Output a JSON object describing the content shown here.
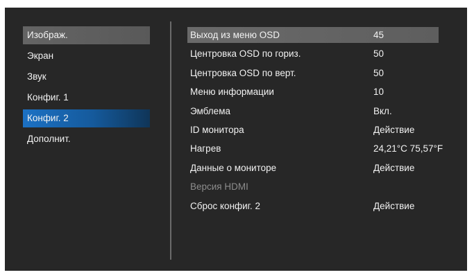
{
  "left_menu": {
    "items": [
      {
        "label": "Изображ."
      },
      {
        "label": "Экран"
      },
      {
        "label": "Звук"
      },
      {
        "label": "Конфиг. 1"
      },
      {
        "label": "Конфиг. 2"
      },
      {
        "label": "Дополнит."
      }
    ],
    "selected_index": 4,
    "highlighted_index": 0
  },
  "settings": {
    "rows": [
      {
        "label": "Выход из меню OSD",
        "value": "45"
      },
      {
        "label": "Центровка OSD по гориз.",
        "value": "50"
      },
      {
        "label": "Центровка OSD по верт.",
        "value": "50"
      },
      {
        "label": "Меню информации",
        "value": "10"
      },
      {
        "label": "Эмблема",
        "value": "Вкл."
      },
      {
        "label": "ID монитора",
        "value": "Действие"
      },
      {
        "label": "Нагрев",
        "value": "24,21°C 75,57°F"
      },
      {
        "label": "Данные о мониторе",
        "value": "Действие"
      },
      {
        "label": "Версия HDMI",
        "value": ""
      },
      {
        "label": "Сброс конфиг. 2",
        "value": "Действие"
      }
    ],
    "highlighted_index": 0,
    "disabled_index": 8
  },
  "colors": {
    "panel_background": "#272727",
    "selected_accent": "#1c71c4",
    "highlight_bar": "#646464",
    "text": "#f2f2f2",
    "disabled_text": "#8c8c8c"
  }
}
